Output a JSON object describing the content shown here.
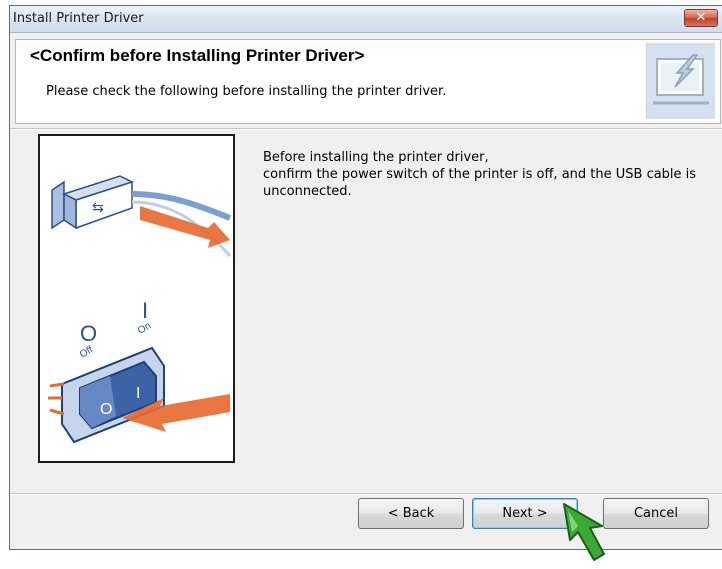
{
  "window": {
    "title": "Install Printer Driver",
    "close_label": "✕"
  },
  "header": {
    "title": "<Confirm before Installing Printer Driver>",
    "subtitle": "Please check the following before installing the printer driver."
  },
  "illustration": {
    "switch_off_label": "Off",
    "switch_on_label": "On",
    "switch_off_symbol": "O",
    "switch_on_symbol": "I"
  },
  "instructions": {
    "line1": "Before installing the printer driver,",
    "line2": "confirm the power switch of the printer is off, and the USB cable is",
    "line3": "unconnected."
  },
  "buttons": {
    "back": "< Back",
    "next": "Next >",
    "cancel": "Cancel"
  },
  "colors": {
    "accent_arrow": "#e8682e",
    "cursor_green": "#3aa935",
    "switch_blue": "#3c63a6"
  }
}
